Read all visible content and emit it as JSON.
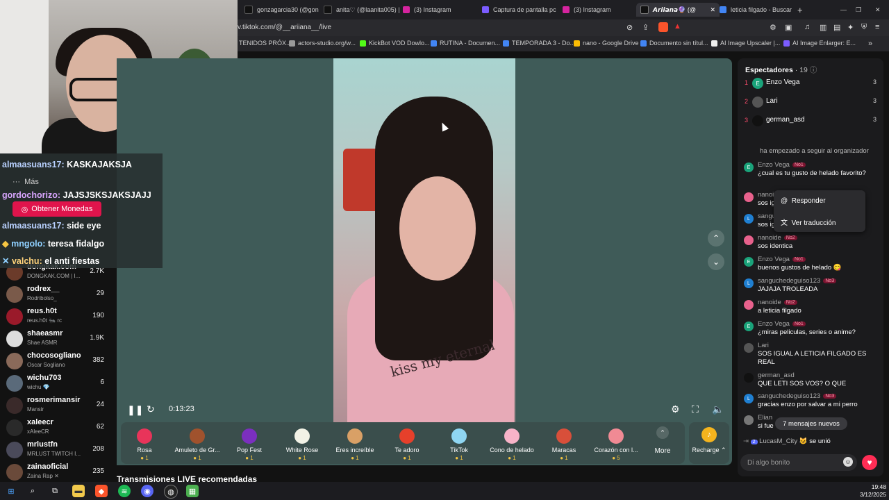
{
  "tabs": [
    {
      "label": "gonzagarcia30 (@gon",
      "active": false
    },
    {
      "label": "anita♡ (@laanita005) |",
      "active": false
    },
    {
      "label": "(3) Instagram",
      "active": false
    },
    {
      "label": "Captura de pantalla pc",
      "active": false
    },
    {
      "label": "(3) Instagram",
      "active": false
    },
    {
      "label": "𝘼𝙧𝙞𝙞𝙖𝙣𝙖🔮 (@",
      "active": true
    },
    {
      "label": "leticia filgado - Buscar",
      "active": false
    }
  ],
  "url": "v.tiktok.com/@__ariiana__/live",
  "bookmarks": [
    "TENIDOS PRÓX...",
    "actors-studio.org/w...",
    "KickBot VOD Dowlo...",
    "RUTINA - Documen...",
    "TEMPORADA 3 - Do...",
    "nano - Google Drive",
    "Documento sin títul...",
    "AI Image Upscaler |...",
    "AI Image Enlarger: E..."
  ],
  "overlay_chat": [
    {
      "user": "almaasuans17:",
      "text": "KASKAJAKSJA"
    },
    {
      "user": "gordochorizo:",
      "text": "JAJSJSKSJAKSJAJJ"
    },
    {
      "user": "almaasuans17:",
      "text": "side eye"
    },
    {
      "user": "mngolo:",
      "text": "teresa fidalgo"
    },
    {
      "user": "valchu:",
      "text": "el anti fiestas"
    }
  ],
  "menu_more": "Más",
  "get_coins": "Obtener Monedas",
  "creators": [
    {
      "name": "dongkak.com",
      "sub": "DONGKAK.COM | I...",
      "count": "2.7K"
    },
    {
      "name": "rodrex__",
      "sub": "Rodribolso_",
      "count": "29"
    },
    {
      "name": "reus.h0t",
      "sub": "reus.h0t 🐜 rc",
      "count": "190"
    },
    {
      "name": "shaeasmr",
      "sub": "Shae ASMR",
      "count": "1.9K"
    },
    {
      "name": "chocosogliano",
      "sub": "Oscar Sogliano",
      "count": "382"
    },
    {
      "name": "wichu703",
      "sub": "wichu 💎",
      "count": "6"
    },
    {
      "name": "rosmerimansir",
      "sub": "Mansir",
      "count": "24"
    },
    {
      "name": "xaleecr",
      "sub": "xAleeCR",
      "count": "62"
    },
    {
      "name": "mrlustfn",
      "sub": "MRLUST TWITCH I...",
      "count": "208"
    },
    {
      "name": "zainaoficial",
      "sub": "Zaina Rap ✕",
      "count": "235"
    }
  ],
  "player": {
    "time": "0:13:23",
    "shirt_text": "kiss my eternal"
  },
  "gifts": [
    {
      "name": "Rosa",
      "price": "1",
      "color": "#e8345a"
    },
    {
      "name": "Amuleto de Gr...",
      "price": "1",
      "color": "#a0522d"
    },
    {
      "name": "Pop Fest",
      "price": "1",
      "color": "#7b2fbf"
    },
    {
      "name": "White Rose",
      "price": "1",
      "color": "#f2f2e6"
    },
    {
      "name": "Eres increíble",
      "price": "1",
      "color": "#d9a066"
    },
    {
      "name": "Te adoro",
      "price": "1",
      "color": "#e6402b"
    },
    {
      "name": "TikTok",
      "price": "1",
      "color": "#8fd6f2"
    },
    {
      "name": "Cono de helado",
      "price": "1",
      "color": "#f7b3c8"
    },
    {
      "name": "Maracas",
      "price": "1",
      "color": "#d84f3a"
    },
    {
      "name": "Corazón con l...",
      "price": "5",
      "color": "#f08a94"
    }
  ],
  "more_label": "More",
  "recharge_label": "Recharge ⌃",
  "recommended_title": "Transmisiones LIVE recomendadas",
  "viewers": {
    "title": "Espectadores",
    "count": "· 19",
    "list": [
      {
        "rank": "1",
        "initial": "E",
        "name": "Enzo Vega",
        "score": "3",
        "color": "#1aa37a"
      },
      {
        "rank": "2",
        "initial": "",
        "name": "Lari",
        "score": "3",
        "color": "#555"
      },
      {
        "rank": "3",
        "initial": "",
        "name": "german_asd",
        "score": "3",
        "color": "#111"
      }
    ]
  },
  "system_msg": "ha empezado a seguir al organizador",
  "messages": [
    {
      "user": "Enzo Vega",
      "badge": "No1",
      "text": "¿cual es tu gusto de helado favorito?",
      "initial": "E",
      "color": "#1aa37a"
    },
    {
      "user": "nanoide",
      "badge": "",
      "text": "sos ig",
      "initial": "",
      "color": "#e8618c"
    },
    {
      "user": "sangu",
      "badge": "",
      "text": "sos ig",
      "initial": "L",
      "color": "#1f7fd1"
    },
    {
      "user": "nanoide",
      "badge": "No2",
      "text": "sos identica",
      "initial": "",
      "color": "#e8618c"
    },
    {
      "user": "Enzo Vega",
      "badge": "No1",
      "text": "buenos gustos de helado 😋",
      "initial": "E",
      "color": "#1aa37a"
    },
    {
      "user": "sanguchedeguiso123",
      "badge": "No3",
      "text": "JAJAJA TROLEADA",
      "initial": "L",
      "color": "#1f7fd1"
    },
    {
      "user": "nanoide",
      "badge": "No2",
      "text": "a leticia filgado",
      "initial": "",
      "color": "#e8618c"
    },
    {
      "user": "Enzo Vega",
      "badge": "No1",
      "text": "¿miras peliculas, series o anime?",
      "initial": "E",
      "color": "#1aa37a"
    },
    {
      "user": "Lari",
      "badge": "",
      "text": "SOS IGUAL A LETICIA FILGADO ES REAL",
      "initial": "",
      "color": "#555"
    },
    {
      "user": "german_asd",
      "badge": "",
      "text": "QUE LETI SOS VOS? O QUE",
      "initial": "",
      "color": "#111"
    },
    {
      "user": "sanguchedeguiso123",
      "badge": "No3",
      "text": "gracias enzo por salvar a mi perro",
      "initial": "L",
      "color": "#1f7fd1"
    },
    {
      "user": "Elian",
      "badge": "",
      "text": "si fue",
      "initial": "",
      "color": "#777"
    }
  ],
  "context_menu": {
    "reply": "Responder",
    "translate": "Ver traducción"
  },
  "new_messages": "7 mensajes nuevos",
  "joined": {
    "badge": "2",
    "user": "LucasM_City 😺",
    "text": "se unió"
  },
  "chat_placeholder": "Di algo bonito",
  "clock": {
    "time": "19:48",
    "date": "3/12/2025"
  }
}
